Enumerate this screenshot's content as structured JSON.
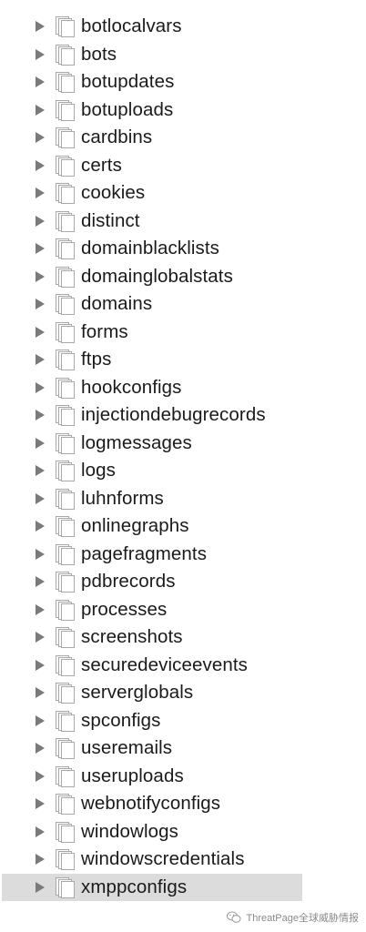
{
  "collections": [
    "botlocalvars",
    "bots",
    "botupdates",
    "botuploads",
    "cardbins",
    "certs",
    "cookies",
    "distinct",
    "domainblacklists",
    "domainglobalstats",
    "domains",
    "forms",
    "ftps",
    "hookconfigs",
    "injectiondebugrecords",
    "logmessages",
    "logs",
    "luhnforms",
    "onlinegraphs",
    "pagefragments",
    "pdbrecords",
    "processes",
    "screenshots",
    "securedeviceevents",
    "serverglobals",
    "spconfigs",
    "useremails",
    "useruploads",
    "webnotifyconfigs",
    "windowlogs",
    "windowscredentials",
    "xmppconfigs"
  ],
  "selected_index": 31,
  "watermark": {
    "text": "ThreatPage全球威胁情报",
    "icon": "wechat-icon"
  },
  "colors": {
    "selection": "#dcdcdc",
    "disclosure": "#7a7a7a",
    "text": "#1a1a1a"
  }
}
